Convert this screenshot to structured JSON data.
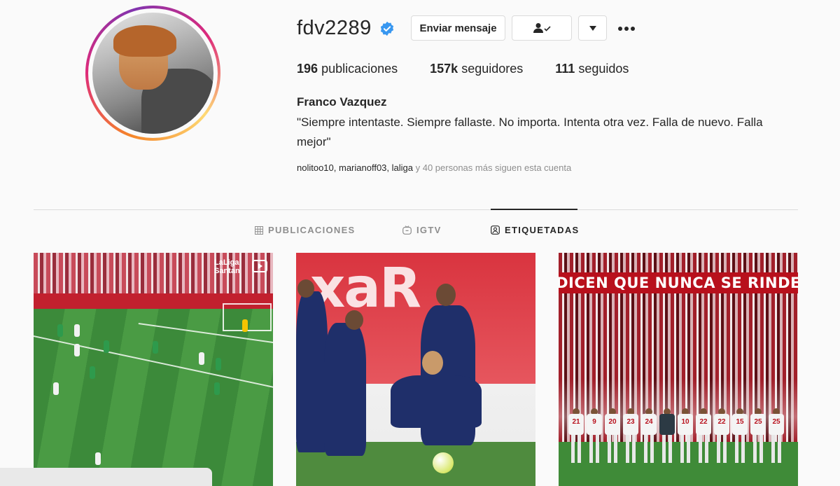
{
  "profile": {
    "username": "fdv2289",
    "full_name": "Franco Vazquez",
    "bio": "\"Siempre intentaste. Siempre fallaste. No importa. Intenta otra vez. Falla de nuevo. Falla mejor\"",
    "verified": true
  },
  "actions": {
    "message_label": "Enviar mensaje",
    "more_icon": "more-horizontal-icon",
    "following_icon": "person-check-icon",
    "dropdown_icon": "chevron-down-icon"
  },
  "stats": {
    "posts_count": "196",
    "posts_label": "publicaciones",
    "followers_count": "157k",
    "followers_label": "seguidores",
    "following_count": "111",
    "following_label": "seguidos"
  },
  "followed_by": {
    "names": "nolitoo10, marianoff03, laliga",
    "suffix": " y 40 personas más siguen esta cuenta"
  },
  "tabs": [
    {
      "label": "PUBLICACIONES",
      "icon": "grid-icon",
      "active": false
    },
    {
      "label": "IGTV",
      "icon": "igtv-icon",
      "active": false
    },
    {
      "label": "ETIQUETADAS",
      "icon": "tagged-icon",
      "active": true
    }
  ],
  "posts": [
    {
      "overlay_text": "LaLiga Santan",
      "kind": "video"
    },
    {
      "overlay_text": "xaR",
      "kind": "image"
    },
    {
      "overlay_text": "DICEN QUE NUNCA SE RINDE",
      "kind": "image",
      "shirt_numbers": [
        "21",
        "9",
        "20",
        "23",
        "24",
        "",
        "10",
        "22",
        "22",
        "15",
        "25",
        "25"
      ]
    }
  ],
  "colors": {
    "verified_blue": "#3897f0",
    "text_primary": "#262626",
    "text_secondary": "#8e8e8e",
    "border": "#dbdbdb"
  }
}
